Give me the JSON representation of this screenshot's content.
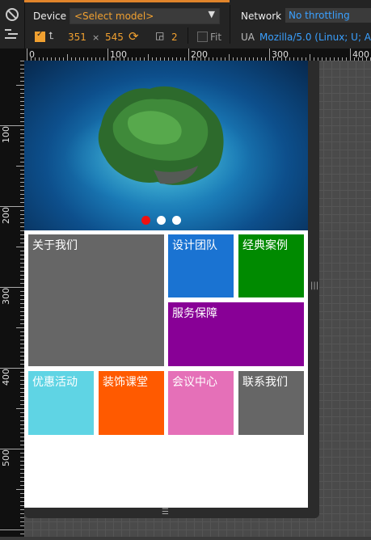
{
  "toolbar": {
    "device_label": "Device",
    "model_select": "<Select model>",
    "network_label": "Network",
    "network_select": "No throttling",
    "width": "351",
    "times": "×",
    "height": "545",
    "dpr": "2",
    "fit_label": "Fit",
    "ua_label": "UA",
    "ua_value": "Mozilla/5.0 (Linux; U; Andr"
  },
  "ruler": {
    "top_labels": [
      "0",
      "100",
      "200",
      "300",
      "400"
    ],
    "left_labels": [
      "100",
      "200",
      "300",
      "400",
      "500"
    ]
  },
  "page": {
    "slider_dots": 3,
    "active_dot": 0,
    "tiles": [
      {
        "id": "about",
        "label": "关于我们",
        "color": "#666666"
      },
      {
        "id": "design",
        "label": "设计团队",
        "color": "#1a73d2"
      },
      {
        "id": "cases",
        "label": "经典案例",
        "color": "#008a00"
      },
      {
        "id": "service",
        "label": "服务保障",
        "color": "#880096"
      },
      {
        "id": "promo",
        "label": "优惠活动",
        "color": "#5fd4e4"
      },
      {
        "id": "class",
        "label": "装饰课堂",
        "color": "#ff5a00"
      },
      {
        "id": "meeting",
        "label": "会议中心",
        "color": "#e570b8"
      },
      {
        "id": "contact",
        "label": "联系我们",
        "color": "#666666"
      }
    ]
  }
}
